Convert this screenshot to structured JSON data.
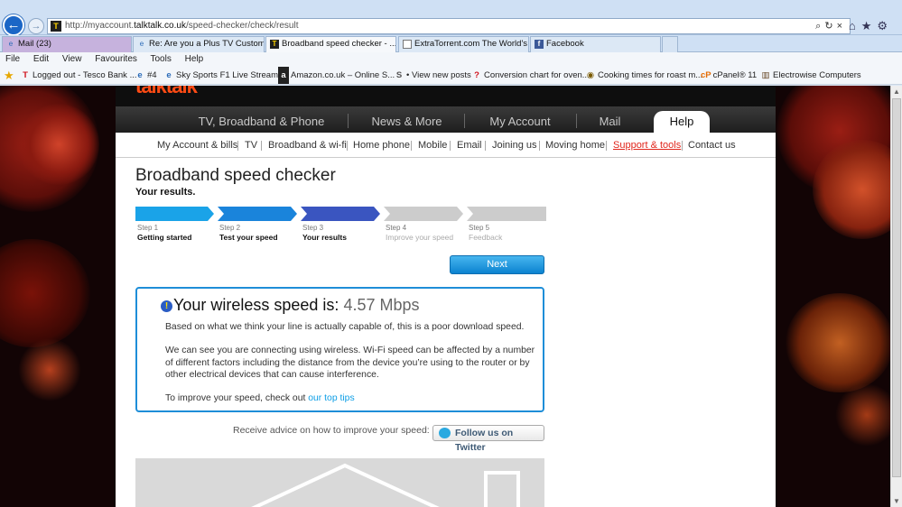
{
  "browser": {
    "url_prefix": "http://myaccount.",
    "url_domain": "talktalk.co.uk",
    "url_path": "/speed-checker/check/result",
    "site_icon_letter": "T",
    "tabs": [
      {
        "label": "Mail (23)"
      },
      {
        "label": "Re: Are you a Plus TV Custome..."
      },
      {
        "label": "Broadband speed checker - ..."
      },
      {
        "label": "ExtraTorrent.com The World's ..."
      },
      {
        "label": "Facebook"
      }
    ],
    "menu": [
      "File",
      "Edit",
      "View",
      "Favourites",
      "Tools",
      "Help"
    ],
    "favourites": [
      {
        "label": "Logged out - Tesco Bank ...",
        "icon": "T"
      },
      {
        "label": "#4",
        "icon": "e"
      },
      {
        "label": "Sky Sports F1 Live Stream ...",
        "icon": "e"
      },
      {
        "label": "Amazon.co.uk – Online S...",
        "icon": "a"
      },
      {
        "label": "• View new posts",
        "icon": "S"
      },
      {
        "label": "Conversion chart for oven...",
        "icon": "?"
      },
      {
        "label": "Cooking times for roast m...",
        "icon": "◉"
      },
      {
        "label": "cPanel® 11",
        "icon": "cP"
      },
      {
        "label": "Electrowise Computers",
        "icon": "▥"
      }
    ]
  },
  "site": {
    "logo": "talktalk",
    "main_nav": [
      "TV, Broadband & Phone",
      "News & More",
      "My Account",
      "Mail",
      "Help"
    ],
    "sub_nav": [
      "My Account & bills",
      "TV",
      "Broadband & wi-fi",
      "Home phone",
      "Mobile",
      "Email",
      "Joining us",
      "Moving home",
      "Support & tools",
      "Contact us"
    ],
    "active_sub_nav": "Support & tools"
  },
  "page": {
    "title": "Broadband speed checker",
    "subtitle": "Your results.",
    "steps": [
      {
        "num": "Step 1",
        "label": "Getting started",
        "color": "#1aa3e8",
        "done": true
      },
      {
        "num": "Step 2",
        "label": "Test your speed",
        "color": "#1a84db",
        "done": true
      },
      {
        "num": "Step 3",
        "label": "Your results",
        "color": "#3a55c0",
        "done": true
      },
      {
        "num": "Step 4",
        "label": "Improve your speed",
        "color": "#cccccc",
        "done": false
      },
      {
        "num": "Step 5",
        "label": "Feedback",
        "color": "#cccccc",
        "done": false
      }
    ],
    "next_label": "Next",
    "result": {
      "heading": "Your wireless speed is:",
      "speed": "4.57 Mbps",
      "para1": "Based on what we think your line is actually capable of, this is a poor download speed.",
      "para2": "We can see you are connecting using wireless. Wi-Fi speed can be affected by a number of different factors including the distance from the device you’re using to the router or by other electrical devices that can cause interference.",
      "tip_prefix": "To improve your speed, check out ",
      "tip_link": "our top tips"
    },
    "advice_text": "Receive advice on how to improve your speed:",
    "twitter_label": "Follow us on Twitter"
  }
}
